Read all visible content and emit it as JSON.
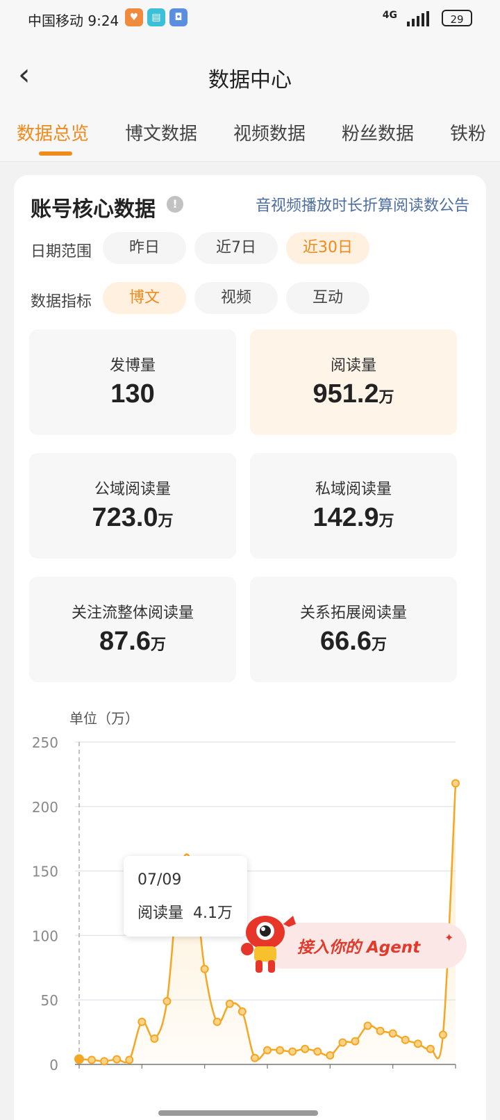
{
  "status_bar": {
    "carrier_time": "中国移动 9:24",
    "signal": "4G",
    "battery": "29"
  },
  "nav": {
    "title": "数据中心"
  },
  "tabs": [
    {
      "label": "数据总览",
      "active": true
    },
    {
      "label": "博文数据",
      "active": false
    },
    {
      "label": "视频数据",
      "active": false
    },
    {
      "label": "粉丝数据",
      "active": false
    },
    {
      "label": "铁粉",
      "active": false
    }
  ],
  "section": {
    "title": "账号核心数据",
    "info_icon": "!",
    "notice_link": "音视频播放时长折算阅读数公告"
  },
  "filters": {
    "date_range": {
      "label": "日期范围",
      "options": [
        "昨日",
        "近7日",
        "近30日"
      ],
      "selected": "近30日"
    },
    "metric": {
      "label": "数据指标",
      "options": [
        "博文",
        "视频",
        "互动"
      ],
      "selected": "博文"
    }
  },
  "metrics": [
    {
      "label": "发博量",
      "value": "130",
      "unit": ""
    },
    {
      "label": "阅读量",
      "value": "951.2",
      "unit": "万",
      "active": true
    },
    {
      "label": "公域阅读量",
      "value": "723.0",
      "unit": "万"
    },
    {
      "label": "私域阅读量",
      "value": "142.9",
      "unit": "万"
    },
    {
      "label": "关注流整体阅读量",
      "value": "87.6",
      "unit": "万"
    },
    {
      "label": "关系拓展阅读量",
      "value": "66.6",
      "unit": "万"
    }
  ],
  "chart_unit": "单位（万）",
  "tooltip": {
    "date": "07/09",
    "label": "阅读量",
    "value": "4.1万"
  },
  "agent_banner": {
    "text": "接入你的 Agent"
  },
  "colors": {
    "accent": "#ef8a1c",
    "link": "#4e6ea0",
    "line": "#f5a623"
  },
  "chart_data": {
    "type": "line",
    "ylabel": "单位（万）",
    "ylim": [
      0,
      250
    ],
    "yticks": [
      0,
      50,
      100,
      150,
      200,
      250
    ],
    "grid": true,
    "series": [
      {
        "values": [
          4.1,
          3.5,
          2.5,
          4,
          3.5,
          33,
          20,
          49,
          148,
          155,
          74,
          33,
          47,
          41,
          5,
          11,
          11,
          10,
          12,
          10,
          7,
          17,
          18,
          30,
          26,
          24,
          19,
          16,
          12,
          23,
          218
        ]
      }
    ]
  }
}
